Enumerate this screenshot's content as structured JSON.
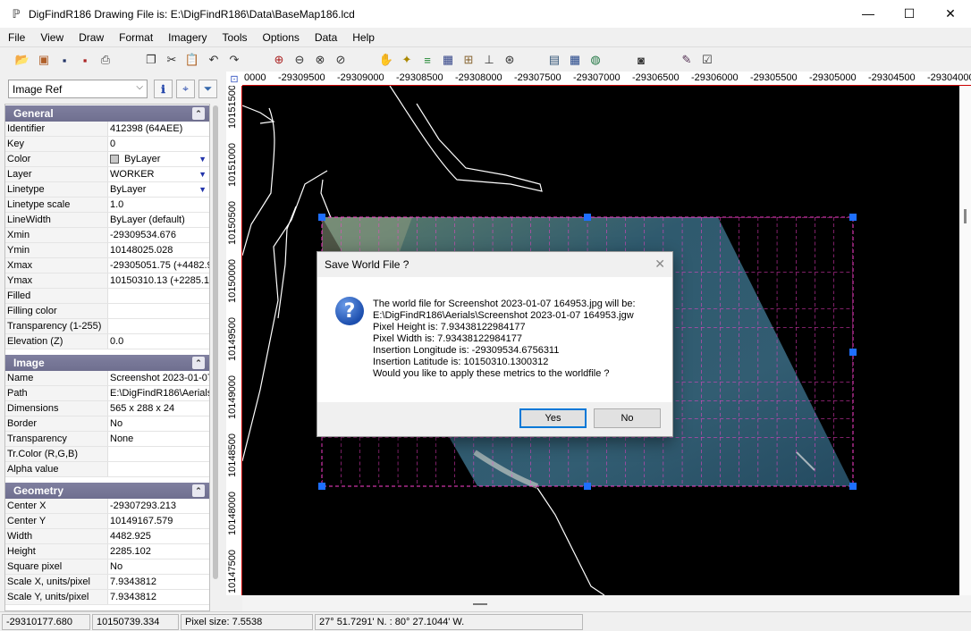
{
  "window": {
    "title": "DigFindR186 Drawing File is: E:\\DigFindR186\\Data\\BaseMap186.lcd",
    "minimize": "—",
    "maximize": "☐",
    "close": "✕"
  },
  "menu": [
    "File",
    "View",
    "Draw",
    "Format",
    "Imagery",
    "Tools",
    "Options",
    "Data",
    "Help"
  ],
  "left_panel": {
    "selector_value": "Image Ref",
    "sections": {
      "general": {
        "title": "General",
        "rows": [
          {
            "name": "Identifier",
            "value": "412398 (64AEE)"
          },
          {
            "name": "Key",
            "value": "0"
          },
          {
            "name": "Color",
            "value": "ByLayer"
          },
          {
            "name": "Layer",
            "value": "WORKER"
          },
          {
            "name": "Linetype",
            "value": "ByLayer"
          },
          {
            "name": "Linetype scale",
            "value": "1.0"
          },
          {
            "name": "LineWidth",
            "value": "ByLayer (default)"
          },
          {
            "name": "Xmin",
            "value": "-29309534.676"
          },
          {
            "name": "Ymin",
            "value": "10148025.028"
          },
          {
            "name": "Xmax",
            "value": "-29305051.75  (+4482.9"
          },
          {
            "name": "Ymax",
            "value": "10150310.13  (+2285.1"
          },
          {
            "name": "Filled",
            "value": ""
          },
          {
            "name": "Filling color",
            "value": ""
          },
          {
            "name": "Transparency (1-255)",
            "value": ""
          },
          {
            "name": "Elevation (Z)",
            "value": "0.0"
          }
        ]
      },
      "image": {
        "title": "Image",
        "rows": [
          {
            "name": "Name",
            "value": "Screenshot 2023-01-07"
          },
          {
            "name": "Path",
            "value": "E:\\DigFindR186\\Aerials"
          },
          {
            "name": "Dimensions",
            "value": "565 x 288 x 24"
          },
          {
            "name": "Border",
            "value": "No"
          },
          {
            "name": "Transparency",
            "value": "None"
          },
          {
            "name": "Tr.Color (R,G,B)",
            "value": ""
          },
          {
            "name": "Alpha value",
            "value": ""
          }
        ]
      },
      "geometry": {
        "title": "Geometry",
        "rows": [
          {
            "name": "Center X",
            "value": "-29307293.213"
          },
          {
            "name": "Center Y",
            "value": "10149167.579"
          },
          {
            "name": "Width",
            "value": "4482.925"
          },
          {
            "name": "Height",
            "value": "2285.102"
          },
          {
            "name": "Square pixel",
            "value": "No"
          },
          {
            "name": "Scale X, units/pixel",
            "value": "7.9343812"
          },
          {
            "name": "Scale Y, units/pixel",
            "value": "7.9343812"
          }
        ]
      }
    }
  },
  "rulers": {
    "horizontal": [
      "0000",
      "-29309500",
      "-29309000",
      "-29308500",
      "-29308000",
      "-29307500",
      "-29307000",
      "-29306500",
      "-29306000",
      "-29305500",
      "-29305000",
      "-29304500",
      "-29304000"
    ],
    "vertical": [
      "10151500",
      "10151000",
      "10150500",
      "10150000",
      "10149500",
      "10149000",
      "10148500",
      "10148000",
      "10147500"
    ]
  },
  "dialog": {
    "title": "Save World File ?",
    "lines": [
      "The world file for Screenshot 2023-01-07 164953.jpg will be:",
      "E:\\DigFindR186\\Aerials\\Screenshot 2023-01-07 164953.jgw",
      "Pixel Height is: 7.93438122984177",
      "Pixel Width is: 7.93438122984177",
      "Insertion Longitude is: -29309534.6756311",
      "Insertion Latitude is: 10150310.1300312",
      "Would you like to apply these metrics to the worldfile ?"
    ],
    "yes": "Yes",
    "no": "No"
  },
  "status": {
    "x": "-29310177.680",
    "y": "10150739.334",
    "pixel_size": "Pixel size: 7.5538",
    "latlon": "27° 51.7291' N.  :  80° 27.1044' W."
  },
  "colors": {
    "grid_line": "#ff3fd0",
    "handle": "#1e6fff",
    "section_header": "#76769a",
    "ruler_border": "#cc0000"
  }
}
